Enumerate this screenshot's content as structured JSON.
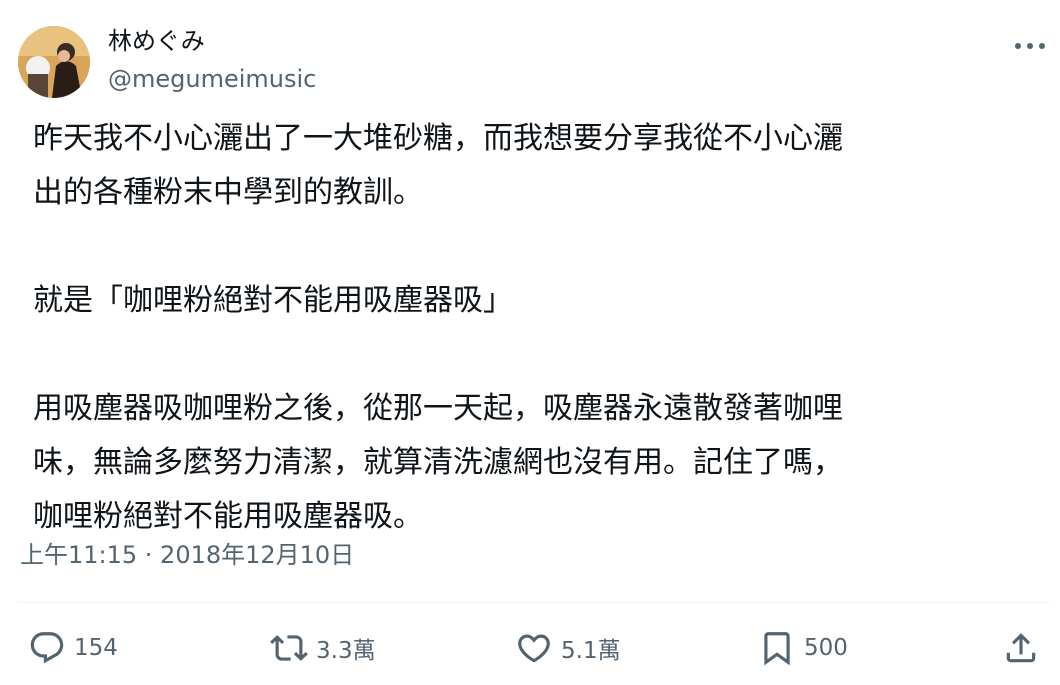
{
  "author": {
    "display_name": "林めぐみ",
    "handle": "@megumeimusic",
    "avatar_icon": "profile-photo"
  },
  "more_icon": "more-horizontal-icon",
  "tweet": {
    "paragraphs": [
      "昨天我不小心灑出了一大堆砂糖，而我想要分享我從不小心灑\n出的各種粉末中學到的教訓。",
      "就是「咖哩粉絕對不能用吸塵器吸」",
      "用吸塵器吸咖哩粉之後，從那一天起，吸塵器永遠散發著咖哩\n味，無論多麼努力清潔，就算清洗濾網也沒有用。記住了嗎，\n咖哩粉絕對不能用吸塵器吸。"
    ],
    "timestamp": "上午11:15 · 2018年12月10日"
  },
  "actions": {
    "reply": {
      "icon": "reply-icon",
      "count": "154"
    },
    "retweet": {
      "icon": "retweet-icon",
      "count": "3.3萬"
    },
    "like": {
      "icon": "heart-icon",
      "count": "5.1萬"
    },
    "bookmark": {
      "icon": "bookmark-icon",
      "count": "500"
    },
    "share": {
      "icon": "share-icon"
    }
  },
  "colors": {
    "text_primary": "#0f1419",
    "text_secondary": "#536471",
    "divider": "#eff3f4"
  }
}
